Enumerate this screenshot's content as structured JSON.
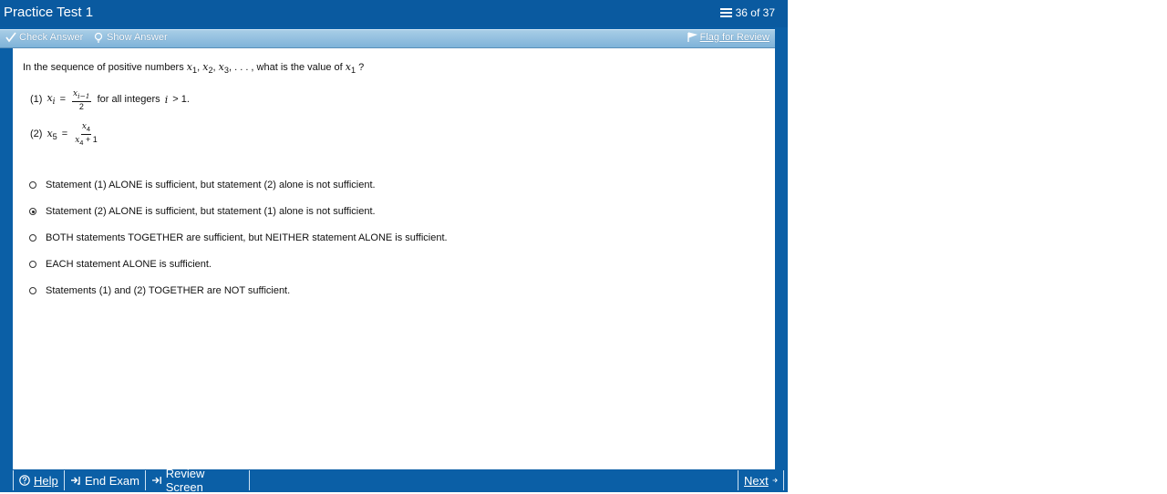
{
  "window": {
    "title": "Practice Test 1",
    "counter": "36 of 37"
  },
  "toolbar": {
    "check_answer": "Check Answer",
    "show_answer": "Show Answer",
    "flag_for_review": "Flag for Review"
  },
  "question": {
    "text_prefix": "In the sequence of positive numbers",
    "x1": "x",
    "sub1": "1",
    "x2": "x",
    "sub2": "2",
    "x3": "x",
    "sub3": "3",
    "dots": ", . . . , what is the value of",
    "x_last": "x",
    "sub_last": "1",
    "qmark": "?"
  },
  "statements": {
    "s1": {
      "label": "(1)",
      "lhs": "x",
      "lhs_sub": "i",
      "eq": "=",
      "num": "x",
      "num_sub": "i−1",
      "den": "2",
      "tail_text": "for all integers",
      "i_var": "i",
      "cond": "> 1."
    },
    "s2": {
      "label": "(2)",
      "lhs": "x",
      "lhs_sub": "5",
      "eq": "=",
      "num": "x",
      "num_sub": "4",
      "den": "x",
      "den_sub": "4",
      "den_tail": "+ 1"
    }
  },
  "options": [
    {
      "text": "Statement (1) ALONE is sufficient, but statement (2) alone is not sufficient.",
      "checked": false
    },
    {
      "text": "Statement (2) ALONE is sufficient, but statement (1) alone is not sufficient.",
      "checked": true
    },
    {
      "text": "BOTH statements TOGETHER are sufficient, but NEITHER statement ALONE is sufficient.",
      "checked": false
    },
    {
      "text": "EACH statement ALONE is sufficient.",
      "checked": false
    },
    {
      "text": "Statements (1) and (2) TOGETHER are NOT sufficient.",
      "checked": false
    }
  ],
  "bottombar": {
    "help": "Help",
    "end_exam": "End Exam",
    "review_screen": "Review Screen",
    "next": "Next"
  },
  "colors": {
    "frame": "#0b5fa6",
    "toolbar": "#8fbfe0",
    "content": "#ffffff"
  }
}
